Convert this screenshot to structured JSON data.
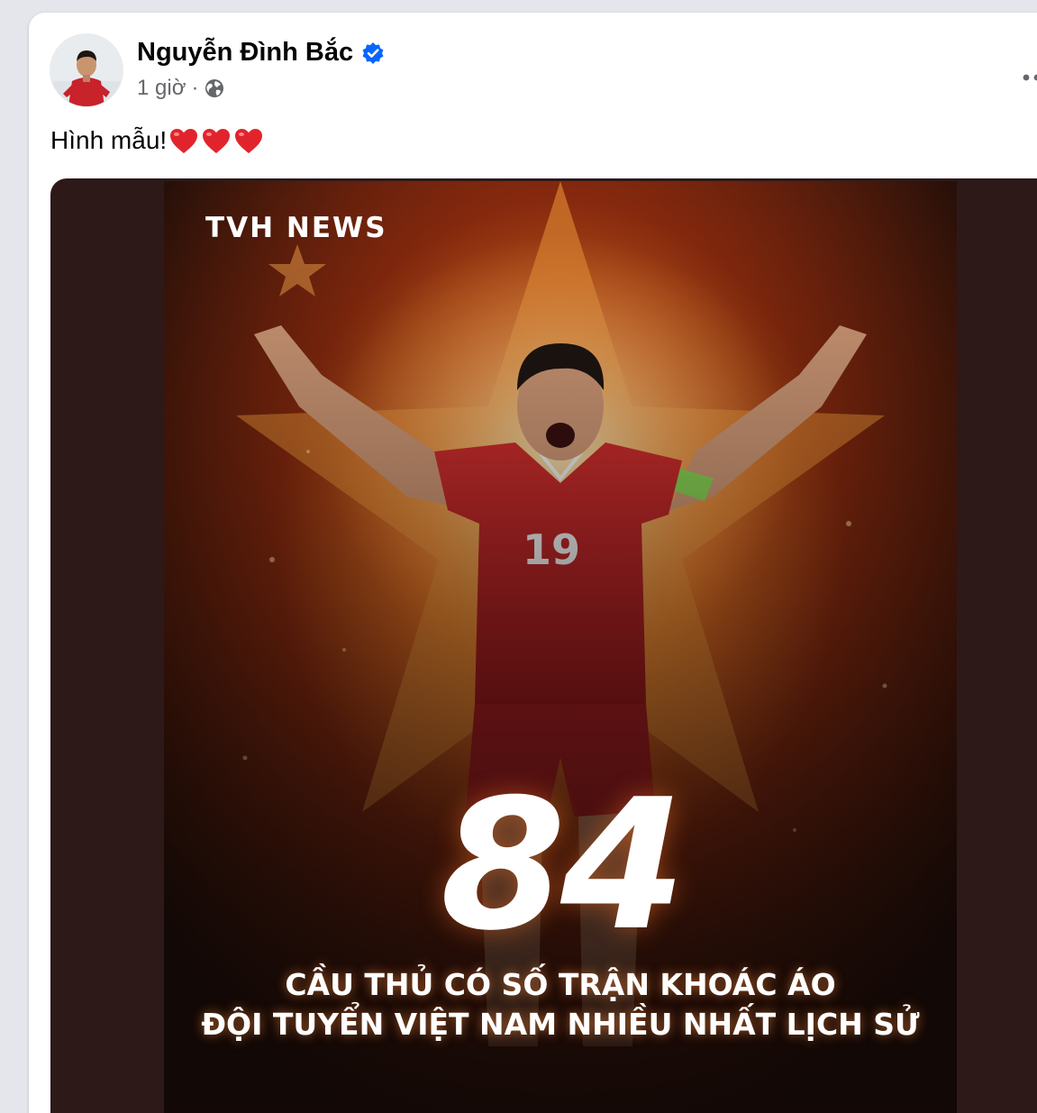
{
  "post": {
    "author": "Nguyễn Đình Bắc",
    "time": "1 giờ",
    "separator": "·",
    "text": "Hình mẫu!",
    "heart_count": 3
  },
  "image": {
    "brand": "TVH NEWS",
    "number": "84",
    "caption_line1": "CẦU THỦ CÓ SỐ TRẬN KHOÁC ÁO",
    "caption_line2": "ĐỘI TUYỂN VIỆT NAM NHIỀU NHẤT LỊCH SỬ",
    "jersey_number": "19"
  },
  "icons": {
    "verified": "verified-badge-icon",
    "audience": "globe-icon",
    "more": "more-options-icon",
    "heart": "red-heart-icon"
  },
  "colors": {
    "verified": "#0866ff",
    "name": "#050505",
    "meta": "#65676b",
    "heart": "#e1242c",
    "jersey": "#c8222a",
    "armband": "#8fe05a",
    "media_bg": "#2e1919"
  }
}
